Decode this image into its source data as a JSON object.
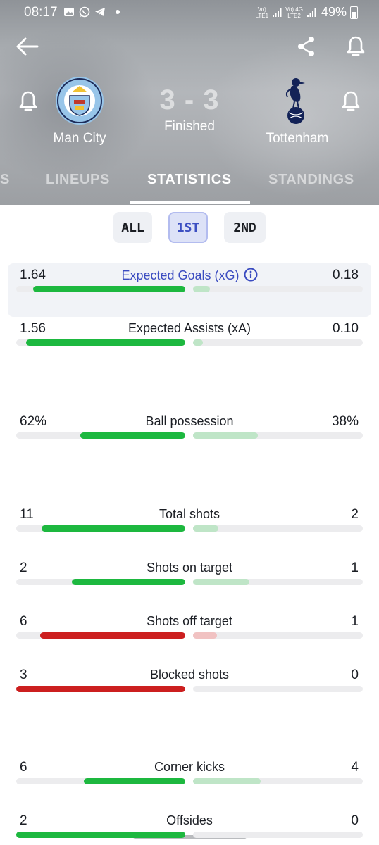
{
  "status_bar": {
    "time": "08:17",
    "network1_top": "Vo)",
    "network1_bottom": "LTE1",
    "network2_top": "Vo) 4G",
    "network2_bottom": "LTE2",
    "battery": "49%"
  },
  "match": {
    "home_team": "Man City",
    "away_team": "Tottenham",
    "score": "3 - 3",
    "status": "Finished"
  },
  "tabs": [
    {
      "label": "S"
    },
    {
      "label": "LINEUPS"
    },
    {
      "label": "STATISTICS"
    },
    {
      "label": "STANDINGS"
    }
  ],
  "active_tab": "STATISTICS",
  "periods": [
    {
      "label": "ALL"
    },
    {
      "label": "1ST"
    },
    {
      "label": "2ND"
    }
  ],
  "active_period": "1ST",
  "colors": {
    "green_strong": "#1db83f",
    "green_light": "#bfe5c7",
    "red_strong": "#cc1f1f",
    "red_light": "#f1c2c2",
    "accent_blue": "#3a4bc0"
  },
  "stats": [
    {
      "label": "Expected Goals (xG)",
      "home": "1.64",
      "away": "0.18",
      "home_share": 0.9,
      "away_share": 0.1,
      "color": "green",
      "highlight": true,
      "info": true
    },
    {
      "label": "Expected Assists (xA)",
      "home": "1.56",
      "away": "0.10",
      "home_share": 0.94,
      "away_share": 0.06,
      "color": "green"
    },
    {
      "label": "Ball possession",
      "home": "62%",
      "away": "38%",
      "home_share": 0.62,
      "away_share": 0.38,
      "color": "green"
    },
    {
      "label": "Total shots",
      "home": "11",
      "away": "2",
      "home_share": 0.85,
      "away_share": 0.15,
      "color": "green"
    },
    {
      "label": "Shots on target",
      "home": "2",
      "away": "1",
      "home_share": 0.67,
      "away_share": 0.33,
      "color": "green"
    },
    {
      "label": "Shots off target",
      "home": "6",
      "away": "1",
      "home_share": 0.86,
      "away_share": 0.14,
      "color": "red"
    },
    {
      "label": "Blocked shots",
      "home": "3",
      "away": "0",
      "home_share": 1.0,
      "away_share": 0.0,
      "color": "red"
    },
    {
      "label": "Corner kicks",
      "home": "6",
      "away": "4",
      "home_share": 0.6,
      "away_share": 0.4,
      "color": "green"
    },
    {
      "label": "Offsides",
      "home": "2",
      "away": "0",
      "home_share": 1.0,
      "away_share": 0.0,
      "color": "green"
    }
  ]
}
